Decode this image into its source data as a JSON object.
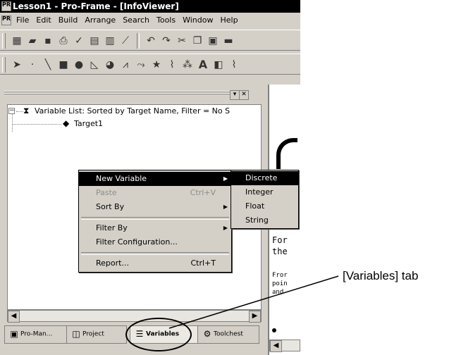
{
  "window": {
    "title": "Lesson1 - Pro-Frame - [InfoViewer]",
    "app_icon_text": "PRO"
  },
  "menubar": {
    "items": [
      "File",
      "Edit",
      "Build",
      "Arrange",
      "Search",
      "Tools",
      "Window",
      "Help"
    ]
  },
  "tree": {
    "root_label": "Variable List: Sorted by Target Name, Filter = No S",
    "child_label": "Target1"
  },
  "context_menu": {
    "new_variable": "New Variable",
    "paste": "Paste",
    "paste_shortcut": "Ctrl+V",
    "sort_by": "Sort By",
    "filter_by": "Filter By",
    "filter_configuration": "Filter Configuration...",
    "report": "Report...",
    "report_shortcut": "Ctrl+T"
  },
  "submenu": {
    "items": [
      "Discrete",
      "Integer",
      "Float",
      "String"
    ]
  },
  "tabs": {
    "pro_man": "Pro-Man...",
    "project": "Project",
    "variables": "Variables",
    "toolchest": "Toolchest"
  },
  "right_pane": {
    "line1": "For",
    "line2": "the",
    "line3": "Fror",
    "line4": "poin",
    "line5": "and"
  },
  "callout": "[Variables] tab",
  "colors": {
    "chrome": "#d4d0c8",
    "titlebar": "#000000",
    "highlight": "#000000"
  }
}
